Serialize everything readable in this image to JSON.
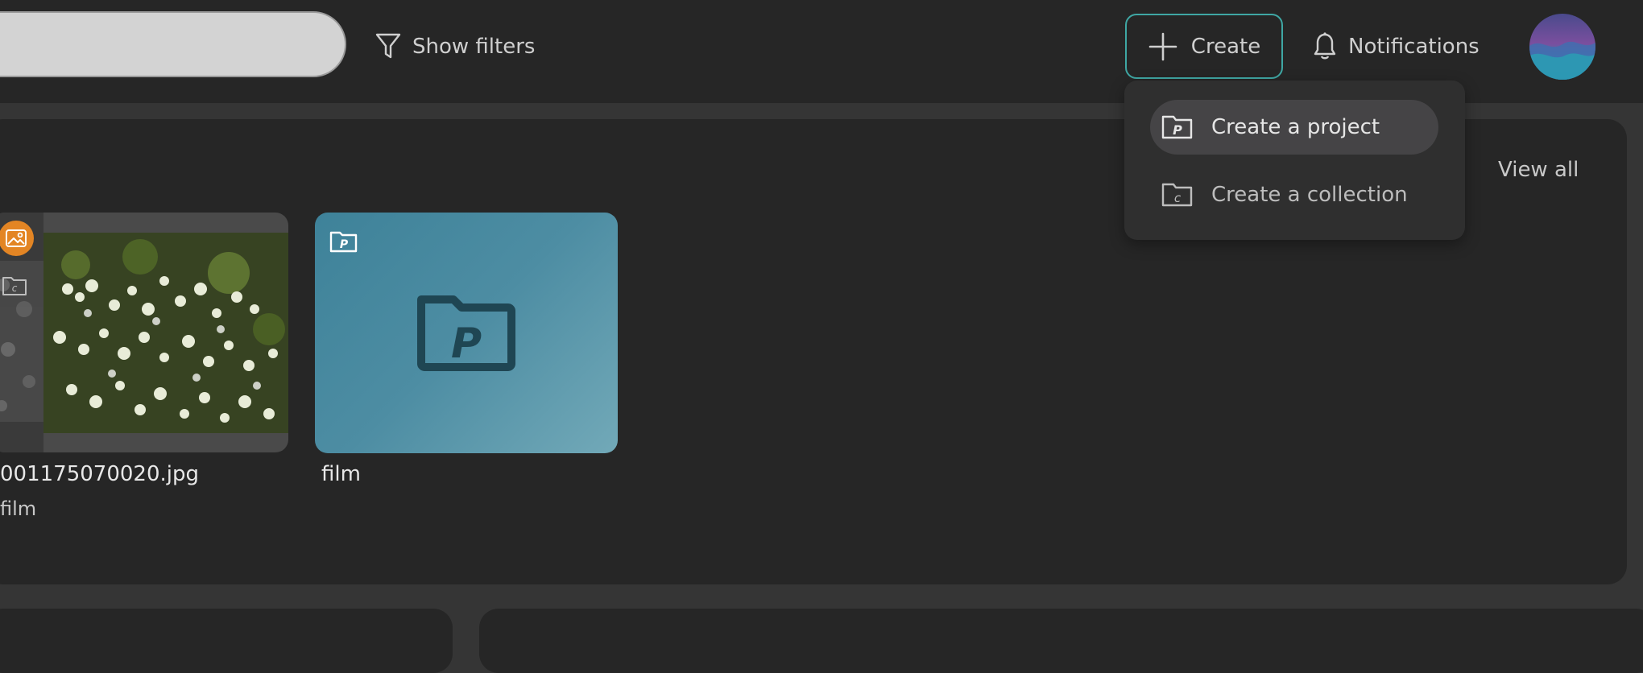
{
  "header": {
    "filters_label": "Show filters",
    "create_label": "Create",
    "notifications_label": "Notifications",
    "accent_color": "#3fa7a4"
  },
  "create_menu": {
    "items": [
      {
        "label": "Create a project",
        "icon": "project-folder-icon"
      },
      {
        "label": "Create a collection",
        "icon": "collection-folder-icon"
      }
    ]
  },
  "section": {
    "view_all_label": "View all",
    "cards": [
      {
        "title": "001175070020.jpg",
        "subtitle": "film",
        "type": "image",
        "badge_color": "#e38524"
      },
      {
        "title": "film",
        "type": "project"
      }
    ]
  }
}
